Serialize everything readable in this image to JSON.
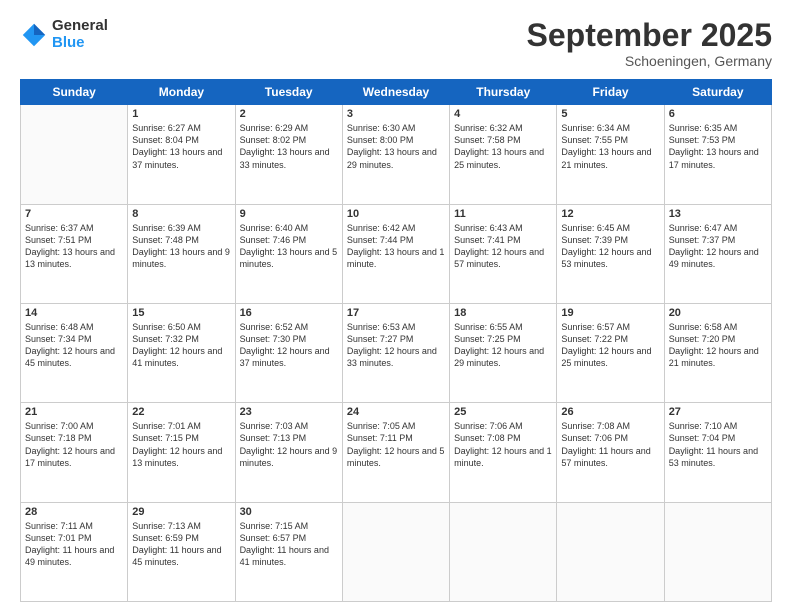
{
  "logo": {
    "general": "General",
    "blue": "Blue"
  },
  "header": {
    "month": "September 2025",
    "location": "Schoeningen, Germany"
  },
  "days": [
    "Sunday",
    "Monday",
    "Tuesday",
    "Wednesday",
    "Thursday",
    "Friday",
    "Saturday"
  ],
  "weeks": [
    [
      {
        "date": "",
        "sunrise": "",
        "sunset": "",
        "daylight": ""
      },
      {
        "date": "1",
        "sunrise": "6:27 AM",
        "sunset": "8:04 PM",
        "daylight": "13 hours and 37 minutes."
      },
      {
        "date": "2",
        "sunrise": "6:29 AM",
        "sunset": "8:02 PM",
        "daylight": "13 hours and 33 minutes."
      },
      {
        "date": "3",
        "sunrise": "6:30 AM",
        "sunset": "8:00 PM",
        "daylight": "13 hours and 29 minutes."
      },
      {
        "date": "4",
        "sunrise": "6:32 AM",
        "sunset": "7:58 PM",
        "daylight": "13 hours and 25 minutes."
      },
      {
        "date": "5",
        "sunrise": "6:34 AM",
        "sunset": "7:55 PM",
        "daylight": "13 hours and 21 minutes."
      },
      {
        "date": "6",
        "sunrise": "6:35 AM",
        "sunset": "7:53 PM",
        "daylight": "13 hours and 17 minutes."
      }
    ],
    [
      {
        "date": "7",
        "sunrise": "6:37 AM",
        "sunset": "7:51 PM",
        "daylight": "13 hours and 13 minutes."
      },
      {
        "date": "8",
        "sunrise": "6:39 AM",
        "sunset": "7:48 PM",
        "daylight": "13 hours and 9 minutes."
      },
      {
        "date": "9",
        "sunrise": "6:40 AM",
        "sunset": "7:46 PM",
        "daylight": "13 hours and 5 minutes."
      },
      {
        "date": "10",
        "sunrise": "6:42 AM",
        "sunset": "7:44 PM",
        "daylight": "13 hours and 1 minute."
      },
      {
        "date": "11",
        "sunrise": "6:43 AM",
        "sunset": "7:41 PM",
        "daylight": "12 hours and 57 minutes."
      },
      {
        "date": "12",
        "sunrise": "6:45 AM",
        "sunset": "7:39 PM",
        "daylight": "12 hours and 53 minutes."
      },
      {
        "date": "13",
        "sunrise": "6:47 AM",
        "sunset": "7:37 PM",
        "daylight": "12 hours and 49 minutes."
      }
    ],
    [
      {
        "date": "14",
        "sunrise": "6:48 AM",
        "sunset": "7:34 PM",
        "daylight": "12 hours and 45 minutes."
      },
      {
        "date": "15",
        "sunrise": "6:50 AM",
        "sunset": "7:32 PM",
        "daylight": "12 hours and 41 minutes."
      },
      {
        "date": "16",
        "sunrise": "6:52 AM",
        "sunset": "7:30 PM",
        "daylight": "12 hours and 37 minutes."
      },
      {
        "date": "17",
        "sunrise": "6:53 AM",
        "sunset": "7:27 PM",
        "daylight": "12 hours and 33 minutes."
      },
      {
        "date": "18",
        "sunrise": "6:55 AM",
        "sunset": "7:25 PM",
        "daylight": "12 hours and 29 minutes."
      },
      {
        "date": "19",
        "sunrise": "6:57 AM",
        "sunset": "7:22 PM",
        "daylight": "12 hours and 25 minutes."
      },
      {
        "date": "20",
        "sunrise": "6:58 AM",
        "sunset": "7:20 PM",
        "daylight": "12 hours and 21 minutes."
      }
    ],
    [
      {
        "date": "21",
        "sunrise": "7:00 AM",
        "sunset": "7:18 PM",
        "daylight": "12 hours and 17 minutes."
      },
      {
        "date": "22",
        "sunrise": "7:01 AM",
        "sunset": "7:15 PM",
        "daylight": "12 hours and 13 minutes."
      },
      {
        "date": "23",
        "sunrise": "7:03 AM",
        "sunset": "7:13 PM",
        "daylight": "12 hours and 9 minutes."
      },
      {
        "date": "24",
        "sunrise": "7:05 AM",
        "sunset": "7:11 PM",
        "daylight": "12 hours and 5 minutes."
      },
      {
        "date": "25",
        "sunrise": "7:06 AM",
        "sunset": "7:08 PM",
        "daylight": "12 hours and 1 minute."
      },
      {
        "date": "26",
        "sunrise": "7:08 AM",
        "sunset": "7:06 PM",
        "daylight": "11 hours and 57 minutes."
      },
      {
        "date": "27",
        "sunrise": "7:10 AM",
        "sunset": "7:04 PM",
        "daylight": "11 hours and 53 minutes."
      }
    ],
    [
      {
        "date": "28",
        "sunrise": "7:11 AM",
        "sunset": "7:01 PM",
        "daylight": "11 hours and 49 minutes."
      },
      {
        "date": "29",
        "sunrise": "7:13 AM",
        "sunset": "6:59 PM",
        "daylight": "11 hours and 45 minutes."
      },
      {
        "date": "30",
        "sunrise": "7:15 AM",
        "sunset": "6:57 PM",
        "daylight": "11 hours and 41 minutes."
      },
      {
        "date": "",
        "sunrise": "",
        "sunset": "",
        "daylight": ""
      },
      {
        "date": "",
        "sunrise": "",
        "sunset": "",
        "daylight": ""
      },
      {
        "date": "",
        "sunrise": "",
        "sunset": "",
        "daylight": ""
      },
      {
        "date": "",
        "sunrise": "",
        "sunset": "",
        "daylight": ""
      }
    ]
  ]
}
